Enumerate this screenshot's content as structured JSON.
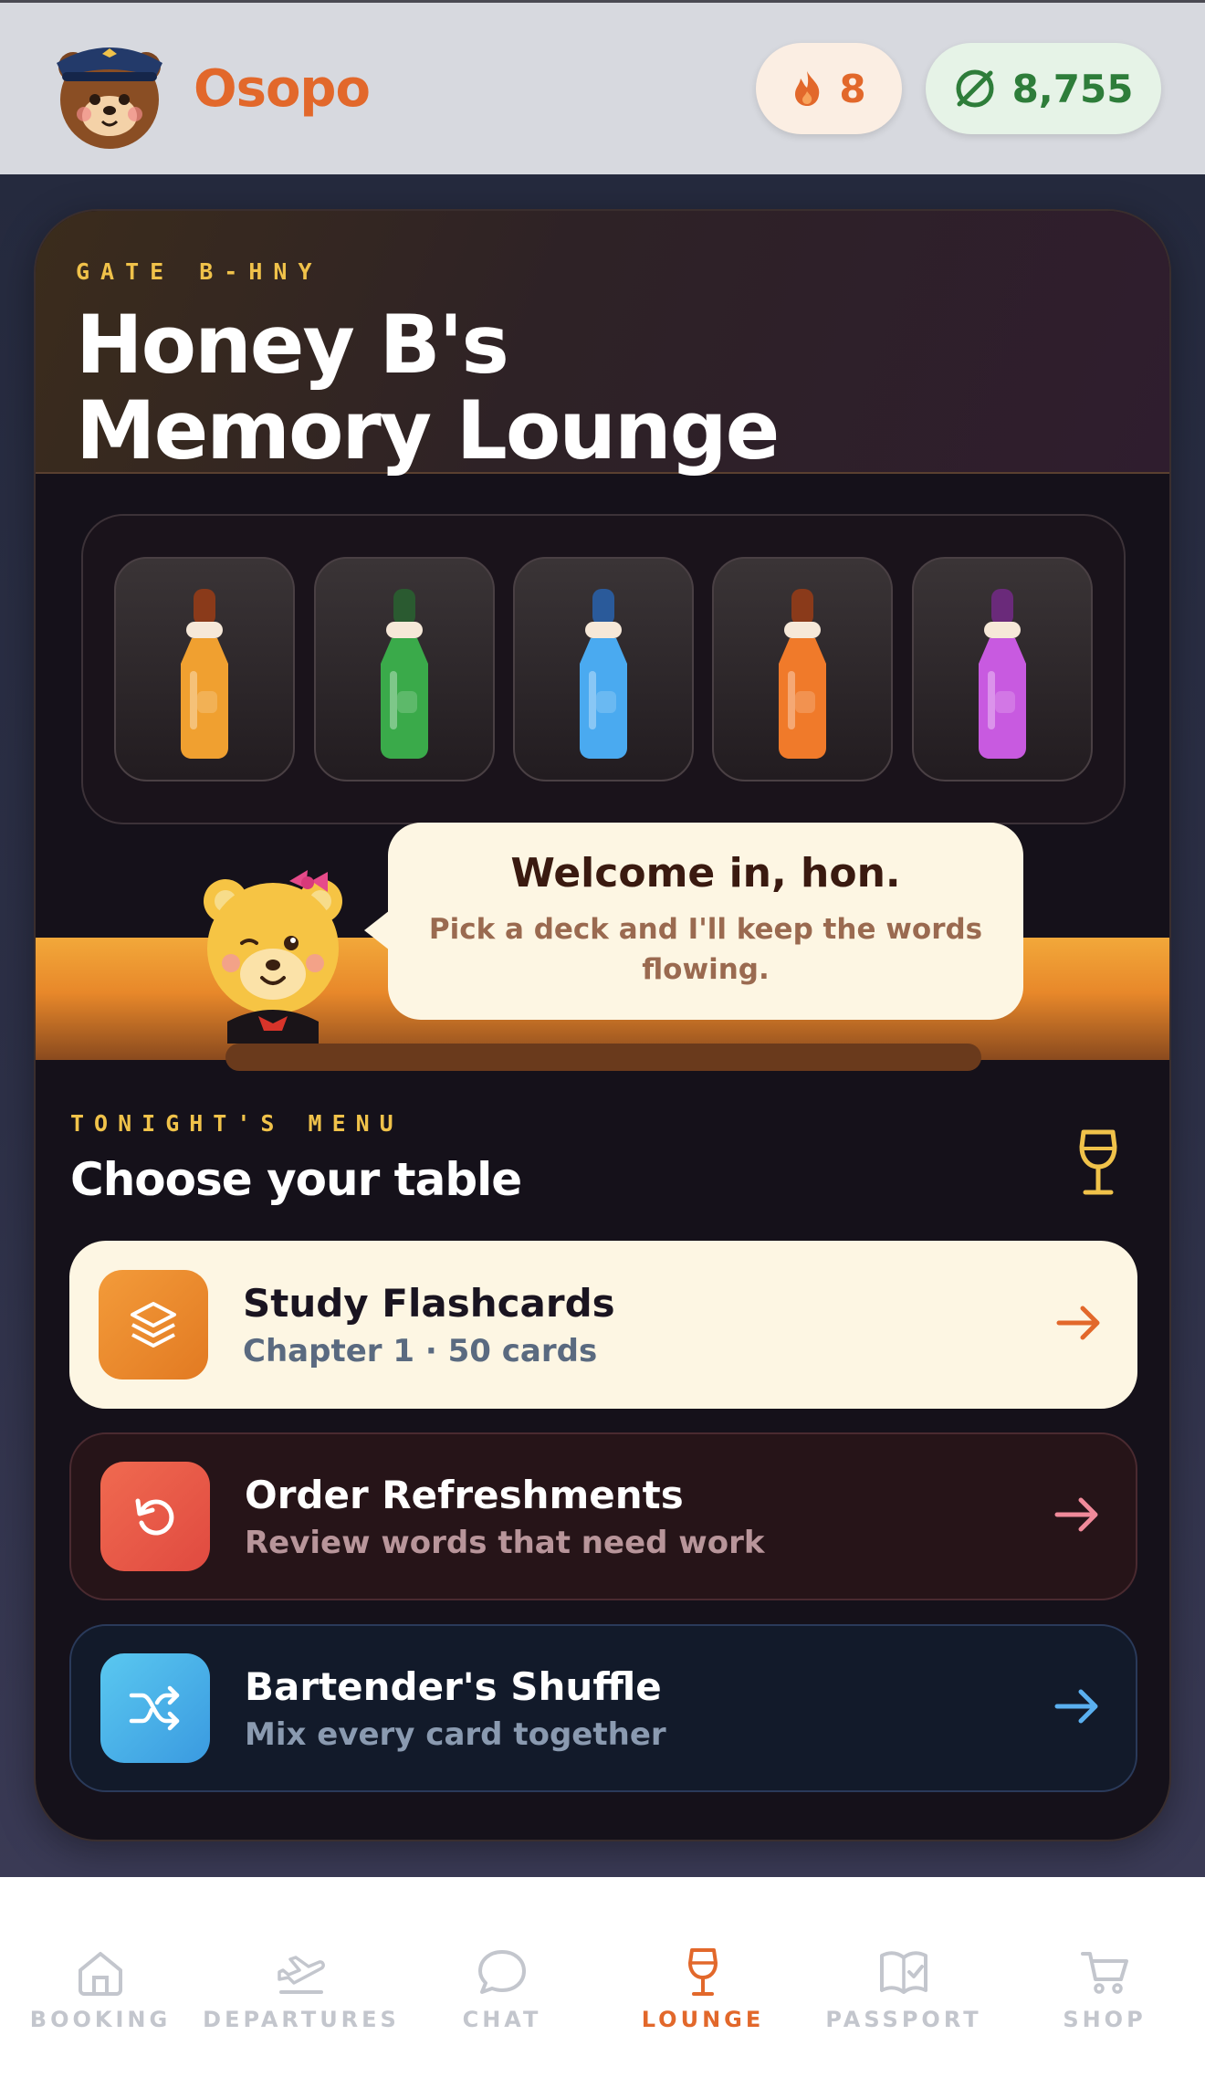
{
  "app": {
    "name": "Osopo"
  },
  "header": {
    "streak_count": "8",
    "coin_balance": "8,755"
  },
  "lounge": {
    "gate_label": "GATE B-HNY",
    "title_line1": "Honey B's",
    "title_line2": "Memory Lounge",
    "bottles": [
      {
        "color": "#f0a030",
        "cap": "#8a3a1a"
      },
      {
        "color": "#3aaa4a",
        "cap": "#2a5a30"
      },
      {
        "color": "#4aaaf0",
        "cap": "#2a5a9a"
      },
      {
        "color": "#f07a2a",
        "cap": "#8a3a1a"
      },
      {
        "color": "#c85ae0",
        "cap": "#6a2a7a"
      }
    ],
    "bubble_title": "Welcome in, hon.",
    "bubble_text": "Pick a deck and I'll keep the words flowing."
  },
  "menu": {
    "kicker": "TONIGHT'S MENU",
    "title": "Choose your table",
    "options": [
      {
        "title": "Study Flashcards",
        "subtitle": "Chapter 1 · 50 cards",
        "icon": "layers-icon",
        "arrow_color": "#e2682b"
      },
      {
        "title": "Order Refreshments",
        "subtitle": "Review words that need work",
        "icon": "refresh-icon",
        "arrow_color": "#f08a9a"
      },
      {
        "title": "Bartender's Shuffle",
        "subtitle": "Mix every card together",
        "icon": "shuffle-icon",
        "arrow_color": "#5ab0f0"
      }
    ]
  },
  "nav": {
    "items": [
      {
        "label": "BOOKING",
        "icon": "home-icon"
      },
      {
        "label": "DEPARTURES",
        "icon": "plane-icon"
      },
      {
        "label": "CHAT",
        "icon": "chat-icon"
      },
      {
        "label": "LOUNGE",
        "icon": "wine-glass-icon",
        "active": true
      },
      {
        "label": "PASSPORT",
        "icon": "passport-icon"
      },
      {
        "label": "SHOP",
        "icon": "cart-icon"
      }
    ]
  },
  "colors": {
    "accent": "#e2682b",
    "gold": "#f0c24a",
    "streak": "#e2682b",
    "coins": "#2e7d3a"
  }
}
